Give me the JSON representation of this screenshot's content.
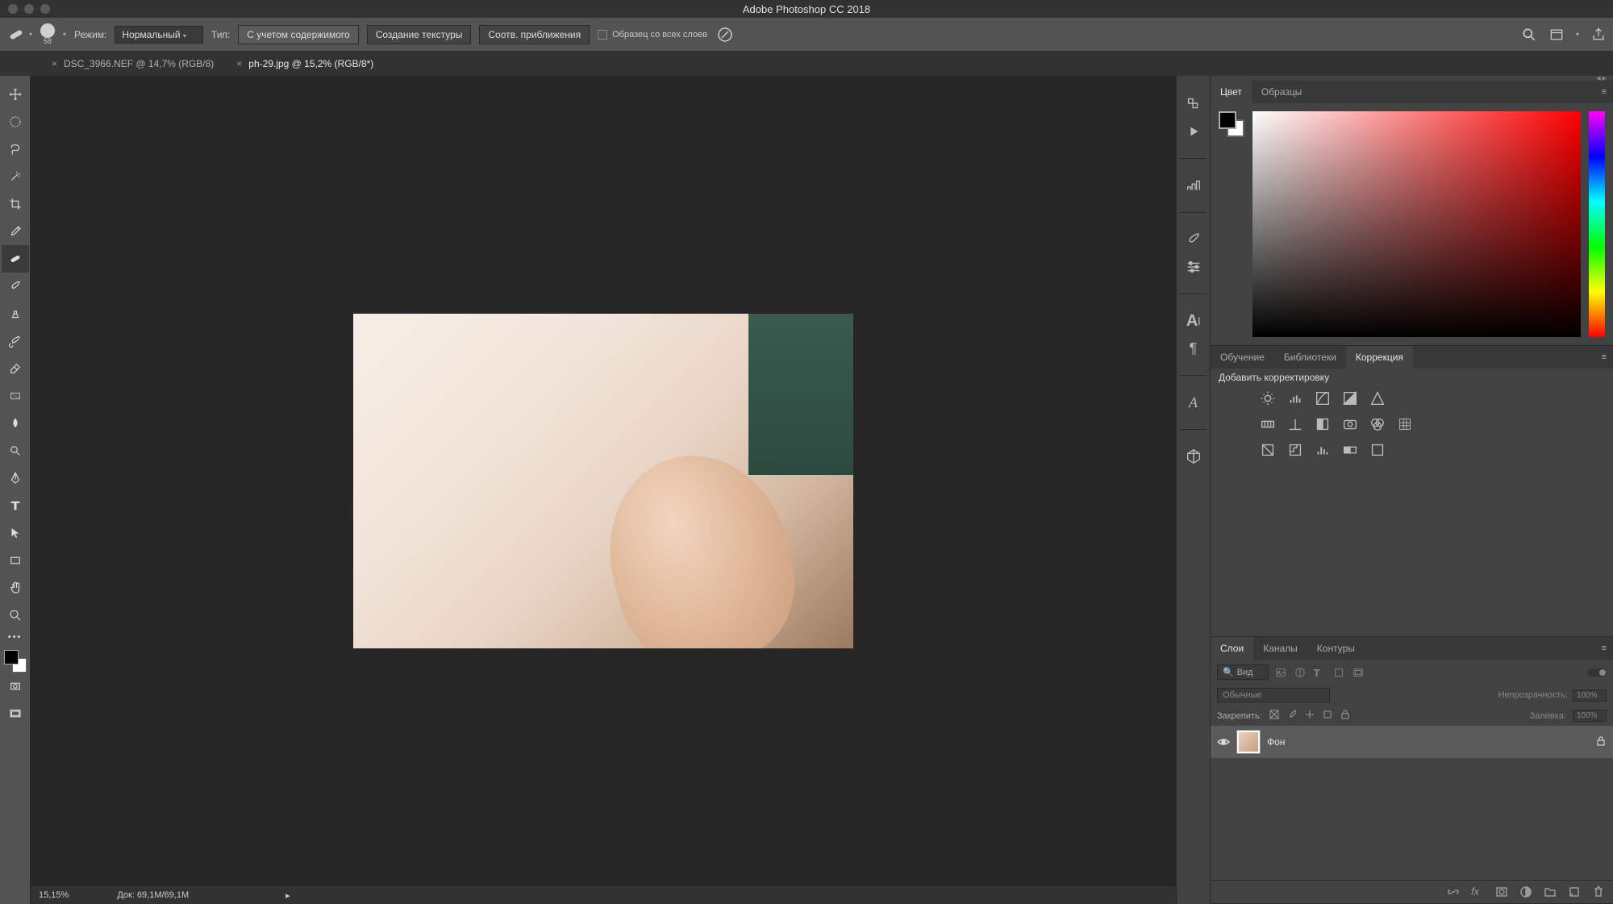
{
  "app_title": "Adobe Photoshop CC 2018",
  "options": {
    "brush_size": "58",
    "mode_label": "Режим:",
    "mode_value": "Нормальный",
    "type_label": "Тип:",
    "content_aware": "С учетом содержимого",
    "create_texture": "Создание текстуры",
    "proximity_match": "Соотв. приближения",
    "sample_all_layers": "Образец со всех слоев"
  },
  "tabs": [
    {
      "label": "DSC_3966.NEF @ 14,7% (RGB/8)",
      "active": false
    },
    {
      "label": "ph-29.jpg @ 15,2% (RGB/8*)",
      "active": true
    }
  ],
  "status": {
    "zoom": "15,15%",
    "doc": "Док: 69,1M/69,1M"
  },
  "panels": {
    "color": {
      "tabs": [
        "Цвет",
        "Образцы"
      ],
      "active": 0
    },
    "library": {
      "tabs": [
        "Обучение",
        "Библиотеки",
        "Коррекция"
      ],
      "active": 2,
      "add_label": "Добавить корректировку"
    },
    "layers": {
      "tabs": [
        "Слои",
        "Каналы",
        "Контуры"
      ],
      "active": 0,
      "filter_label": "Вид",
      "blend_mode": "Обычные",
      "opacity_label": "Непрозрачность:",
      "opacity_value": "100%",
      "lock_label": "Закрепить:",
      "fill_label": "Заливка:",
      "fill_value": "100%",
      "layer_name": "Фон"
    }
  }
}
